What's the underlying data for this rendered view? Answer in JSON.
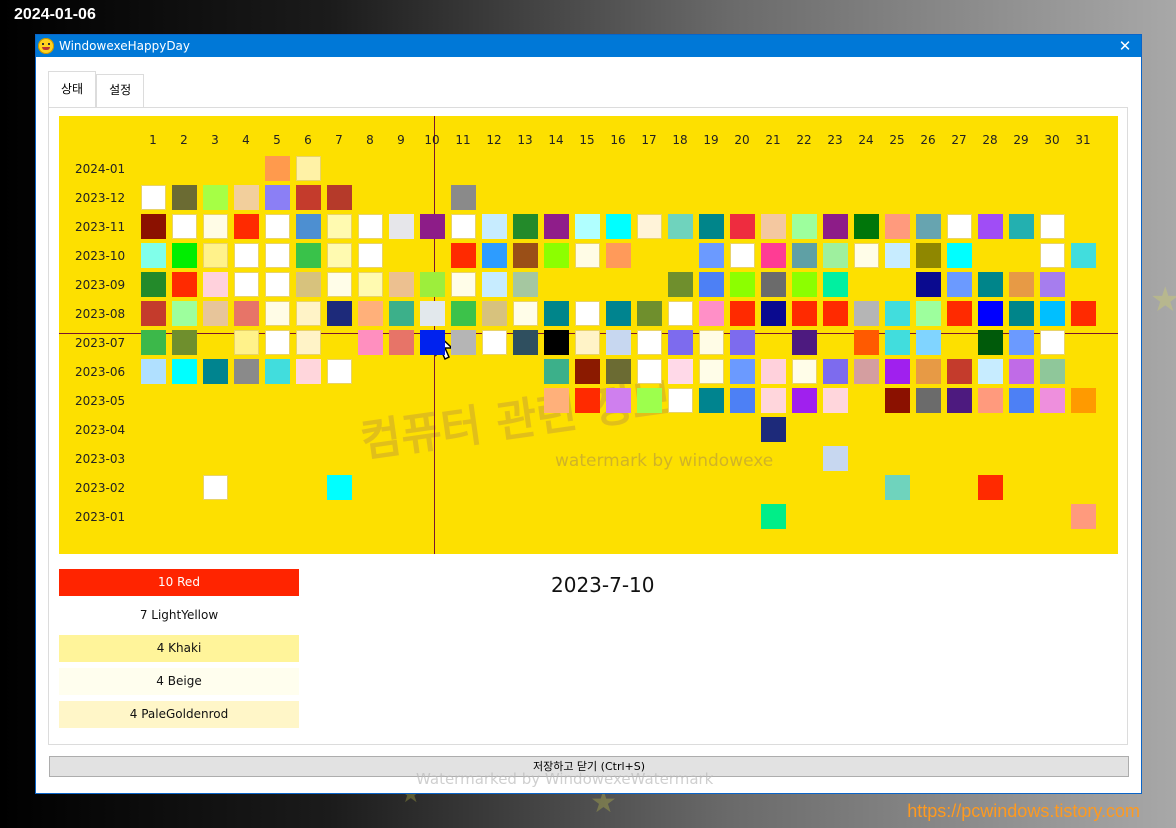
{
  "desktop": {
    "date": "2024-01-06",
    "url": "https://pcwindows.tistory.com"
  },
  "window": {
    "title": "WindowexeHappyDay",
    "close_glyph": "✕"
  },
  "tabs": [
    {
      "label": "상태",
      "active": true
    },
    {
      "label": "설정",
      "active": false
    }
  ],
  "calendar": {
    "days": [
      "1",
      "2",
      "3",
      "4",
      "5",
      "6",
      "7",
      "8",
      "9",
      "10",
      "11",
      "12",
      "13",
      "14",
      "15",
      "16",
      "17",
      "18",
      "19",
      "20",
      "21",
      "22",
      "23",
      "24",
      "25",
      "26",
      "27",
      "28",
      "29",
      "30",
      "31"
    ],
    "rows": [
      {
        "month": "2024-01",
        "cells": {
          "5": "#ff9a4d",
          "6": "#fff2a6"
        }
      },
      {
        "month": "2023-12",
        "cells": {
          "1": "#ffffff",
          "2": "#6b6b33",
          "3": "#a6ff45",
          "4": "#f2cf9c",
          "5": "#8b7ff5",
          "6": "#c43b2c",
          "7": "#b53a2a",
          "11": "#8a8a8a"
        }
      },
      {
        "month": "2023-11",
        "cells": {
          "1": "#8b1100",
          "2": "#ffffff",
          "3": "#fffce6",
          "4": "#ff2a00",
          "5": "#ffffff",
          "6": "#4d8fd1",
          "7": "#fffab0",
          "8": "#ffffff",
          "9": "#e6e6ea",
          "10": "#8d1c88",
          "11": "#ffffff",
          "12": "#c7ecff",
          "13": "#238a2a",
          "14": "#8f1d8a",
          "15": "#b0ffff",
          "16": "#00ffff",
          "17": "#fff3d9",
          "18": "#6fd3bd",
          "19": "#00858a",
          "20": "#ee2c3f",
          "21": "#f4c8a0",
          "22": "#9dff9d",
          "23": "#8d1c88",
          "24": "#00760a",
          "25": "#ff9a7d",
          "26": "#67a4b0",
          "27": "#ffffff",
          "28": "#a04df6",
          "29": "#23b0b0",
          "30": "#ffffff"
        }
      },
      {
        "month": "2023-10",
        "cells": {
          "1": "#80ffea",
          "2": "#00ee00",
          "3": "#fff28a",
          "4": "#ffffff",
          "5": "#ffffff",
          "6": "#39c24a",
          "7": "#fffab0",
          "8": "#ffffff",
          "11": "#ff2a00",
          "12": "#2d9cff",
          "13": "#9a4f17",
          "14": "#8cff00",
          "15": "#fffce6",
          "16": "#ff9a5a",
          "19": "#6b9aff",
          "20": "#ffffff",
          "21": "#ff3c94",
          "22": "#5fa0a5",
          "23": "#9ef09e",
          "24": "#fffde8",
          "25": "#c7ecff",
          "26": "#8f8700",
          "27": "#00ffff",
          "30": "#ffffff",
          "31": "#41dddd"
        }
      },
      {
        "month": "2023-09",
        "cells": {
          "1": "#238a2a",
          "2": "#ff2a00",
          "3": "#ffd1dc",
          "4": "#ffffff",
          "5": "#ffffff",
          "6": "#d7c27d",
          "7": "#fffde8",
          "8": "#fffab0",
          "9": "#ecc090",
          "10": "#9dee3c",
          "11": "#fffde8",
          "12": "#c7ecff",
          "13": "#a5c7a0",
          "18": "#6f8f2d",
          "19": "#4d80f5",
          "20": "#8cff00",
          "21": "#6b6b6b",
          "22": "#8cff00",
          "23": "#00f0a0",
          "26": "#0a0a8f",
          "27": "#6b9aff",
          "28": "#00858a",
          "29": "#e79a45",
          "30": "#a67dee"
        }
      },
      {
        "month": "2023-08",
        "cells": {
          "1": "#c43b2c",
          "2": "#9dff9d",
          "3": "#e7c59a",
          "4": "#e77468",
          "5": "#fffce6",
          "6": "#fff3c7",
          "7": "#1d2a7a",
          "8": "#ffb07a",
          "9": "#3cb08a",
          "10": "#e2e8ec",
          "11": "#3cc24a",
          "12": "#d7c27d",
          "13": "#fffde8",
          "14": "#00858a",
          "15": "#ffffff",
          "16": "#00848f",
          "17": "#6f8f2d",
          "18": "#ffffff",
          "19": "#ff8fc7",
          "20": "#ff2a00",
          "21": "#0a0a8f",
          "22": "#ff2a00",
          "23": "#ff2a00",
          "24": "#b5b5b5",
          "25": "#41dddd",
          "26": "#9dff9d",
          "27": "#ff2a00",
          "28": "#0000ff",
          "29": "#00858a",
          "30": "#00bfff",
          "31": "#ff2a00"
        }
      },
      {
        "month": "2023-07",
        "cells": {
          "1": "#3cb84a",
          "2": "#6f8f2d",
          "4": "#fff28a",
          "5": "#ffffff",
          "6": "#fff3c7",
          "8": "#ff8fbf",
          "9": "#e77468",
          "10": "#0022ee",
          "11": "#b5b5b5",
          "12": "#ffffff",
          "13": "#2f4f5f",
          "14": "#000000",
          "15": "#fff3c7",
          "16": "#c7d7f0",
          "17": "#ffffff",
          "18": "#7d6bee",
          "19": "#fffce6",
          "20": "#7d6bee",
          "22": "#4d1a7f",
          "24": "#ff5a00",
          "25": "#41dddd",
          "26": "#80d4ff",
          "28": "#005a0a",
          "29": "#6b9aff",
          "30": "#ffffff"
        }
      },
      {
        "month": "2023-06",
        "cells": {
          "1": "#b0e0ff",
          "2": "#00ffff",
          "3": "#00848f",
          "4": "#8a8a8a",
          "5": "#41dddd",
          "6": "#ffd6dc",
          "7": "#ffffff",
          "14": "#3cb08a",
          "15": "#8b1a00",
          "16": "#6b6b33",
          "17": "#ffffff",
          "18": "#ffd9e8",
          "19": "#fffde8",
          "20": "#6b9aff",
          "21": "#ffd1dc",
          "22": "#fffde8",
          "23": "#7d6bee",
          "24": "#d49ea0",
          "25": "#a020ee",
          "26": "#e79a45",
          "27": "#c43b2c",
          "28": "#c7ecff",
          "29": "#c06be7",
          "30": "#8fc79a"
        }
      },
      {
        "month": "2023-05",
        "cells": {
          "14": "#ffb07a",
          "15": "#ff2a00",
          "16": "#cf7fee",
          "17": "#9dff4d",
          "18": "#ffffff",
          "19": "#00848f",
          "20": "#4d80f5",
          "21": "#ffd6dc",
          "22": "#a020ee",
          "23": "#ffd6dc",
          "25": "#8b1100",
          "26": "#6b6b6b",
          "27": "#4d1a7f",
          "28": "#ff9a7d",
          "29": "#4d80f5",
          "30": "#ee8fdd",
          "31": "#ff9a00"
        }
      },
      {
        "month": "2023-04",
        "cells": {
          "21": "#1d2a7a"
        }
      },
      {
        "month": "2023-03",
        "cells": {
          "23": "#c7d7f0"
        }
      },
      {
        "month": "2023-02",
        "cells": {
          "3": "#ffffff",
          "7": "#00ffff",
          "25": "#6fd3bd",
          "28": "#ff2a00"
        }
      },
      {
        "month": "2023-01",
        "cells": {
          "21": "#00ee88",
          "31": "#ff9a7d"
        }
      }
    ],
    "watermark_ko": "컴퓨터 관련 정보",
    "watermark_en": "watermark by windowexe"
  },
  "legend": [
    {
      "label": "10 Red",
      "color": "#ff2400",
      "text_color": "#ffffff"
    },
    {
      "label": "7 LightYellow",
      "color": "#ffffff",
      "text_color": "#111111"
    },
    {
      "label": "4 Khaki",
      "color": "#fff49a",
      "text_color": "#111111"
    },
    {
      "label": "4 Beige",
      "color": "#fffeee",
      "text_color": "#111111"
    },
    {
      "label": "4 PaleGoldenrod",
      "color": "#fff6c8",
      "text_color": "#111111"
    }
  ],
  "selected_date": "2023-7-10",
  "save_button": {
    "label": "저장하고 닫기 (Ctrl+S)"
  },
  "footer_watermark": "Watermarked by WindowexeWatermark"
}
